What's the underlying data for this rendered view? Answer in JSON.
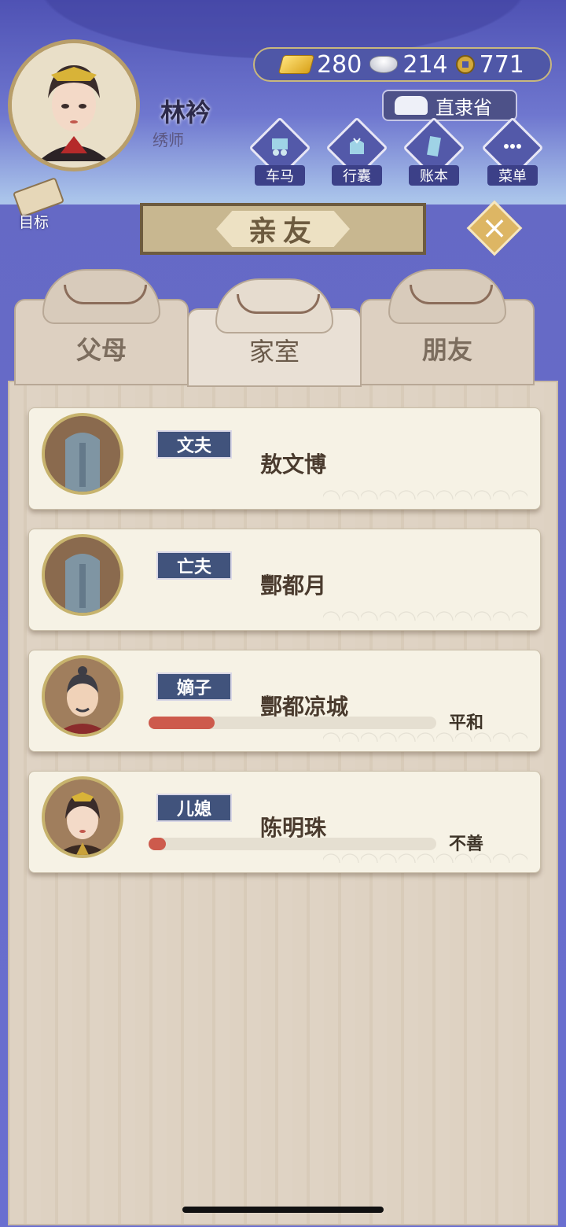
{
  "player": {
    "name": "林衿",
    "title": "绣师"
  },
  "currency": {
    "gold": "280",
    "silver": "214",
    "coin": "771"
  },
  "location": "直隶省",
  "menu": [
    {
      "label": "车马",
      "icon": "carriage-icon"
    },
    {
      "label": "行囊",
      "icon": "bundle-icon"
    },
    {
      "label": "账本",
      "icon": "ledger-icon"
    },
    {
      "label": "菜单",
      "icon": "more-icon"
    }
  ],
  "goal_label": "目标",
  "panel_title": "亲友",
  "tabs": [
    {
      "label": "父母",
      "active": false
    },
    {
      "label": "家室",
      "active": true
    },
    {
      "label": "朋友",
      "active": false
    }
  ],
  "relatives": [
    {
      "role": "文夫",
      "name": "敖文博",
      "portrait": "tombstone",
      "mood": null,
      "mood_value": null
    },
    {
      "role": "亡夫",
      "name": "酆都月",
      "portrait": "tombstone",
      "mood": null,
      "mood_value": null
    },
    {
      "role": "嫡子",
      "name": "酆都凉城",
      "portrait": "man",
      "mood": "平和",
      "mood_value": 0.23
    },
    {
      "role": "儿媳",
      "name": "陈明珠",
      "portrait": "woman",
      "mood": "不善",
      "mood_value": 0.06
    }
  ],
  "colors": {
    "accent": "#41537c",
    "bar": "#cd5a4c",
    "wood": "#ded2c2"
  }
}
